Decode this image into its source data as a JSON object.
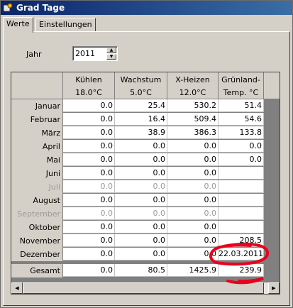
{
  "window": {
    "title": "Grad Tage"
  },
  "tabs": [
    {
      "label": "Werte",
      "active": true
    },
    {
      "label": "Einstellungen",
      "active": false
    }
  ],
  "year": {
    "label": "Jahr",
    "value": "2011"
  },
  "table": {
    "columns": [
      {
        "line1": "Kühlen",
        "line2": "18.0°C"
      },
      {
        "line1": "Wachstum",
        "line2": "5.0°C"
      },
      {
        "line1": "X-Heizen",
        "line2": "12.0°C"
      },
      {
        "line1": "Grünland-",
        "line2": "Temp. °C"
      }
    ],
    "rows": [
      {
        "month": "Januar",
        "dim": false,
        "values": [
          "0.0",
          "25.4",
          "530.2",
          "51.4"
        ]
      },
      {
        "month": "Februar",
        "dim": false,
        "values": [
          "0.0",
          "16.4",
          "509.4",
          "54.6"
        ]
      },
      {
        "month": "März",
        "dim": false,
        "values": [
          "0.0",
          "38.9",
          "386.3",
          "133.8"
        ]
      },
      {
        "month": "April",
        "dim": false,
        "values": [
          "0.0",
          "0.0",
          "0.0",
          "0.0"
        ]
      },
      {
        "month": "Mai",
        "dim": false,
        "values": [
          "0.0",
          "0.0",
          "0.0",
          "0.0"
        ]
      },
      {
        "month": "Juni",
        "dim": false,
        "values": [
          "0.0",
          "0.0",
          "0.0",
          ""
        ]
      },
      {
        "month": "Juli",
        "dim": true,
        "values": [
          "0.0",
          "0.0",
          "0.0",
          ""
        ]
      },
      {
        "month": "August",
        "dim": false,
        "values": [
          "0.0",
          "0.0",
          "0.0",
          ""
        ]
      },
      {
        "month": "September",
        "dim": true,
        "values": [
          "0.0",
          "0.0",
          "0.0",
          ""
        ]
      },
      {
        "month": "Oktober",
        "dim": false,
        "values": [
          "0.0",
          "0.0",
          "0.0",
          ""
        ]
      },
      {
        "month": "November",
        "dim": false,
        "values": [
          "0.0",
          "0.0",
          "0.0",
          "208.5"
        ]
      },
      {
        "month": "Dezember",
        "dim": false,
        "values": [
          "0.0",
          "0.0",
          "0.0",
          "22.03.2011"
        ]
      }
    ],
    "total": {
      "month": "Gesamt",
      "values": [
        "0.0",
        "80.5",
        "1425.9",
        "239.9"
      ]
    }
  },
  "colors": {
    "annotation": "#e8001c",
    "titlebar": "#0a246a"
  }
}
